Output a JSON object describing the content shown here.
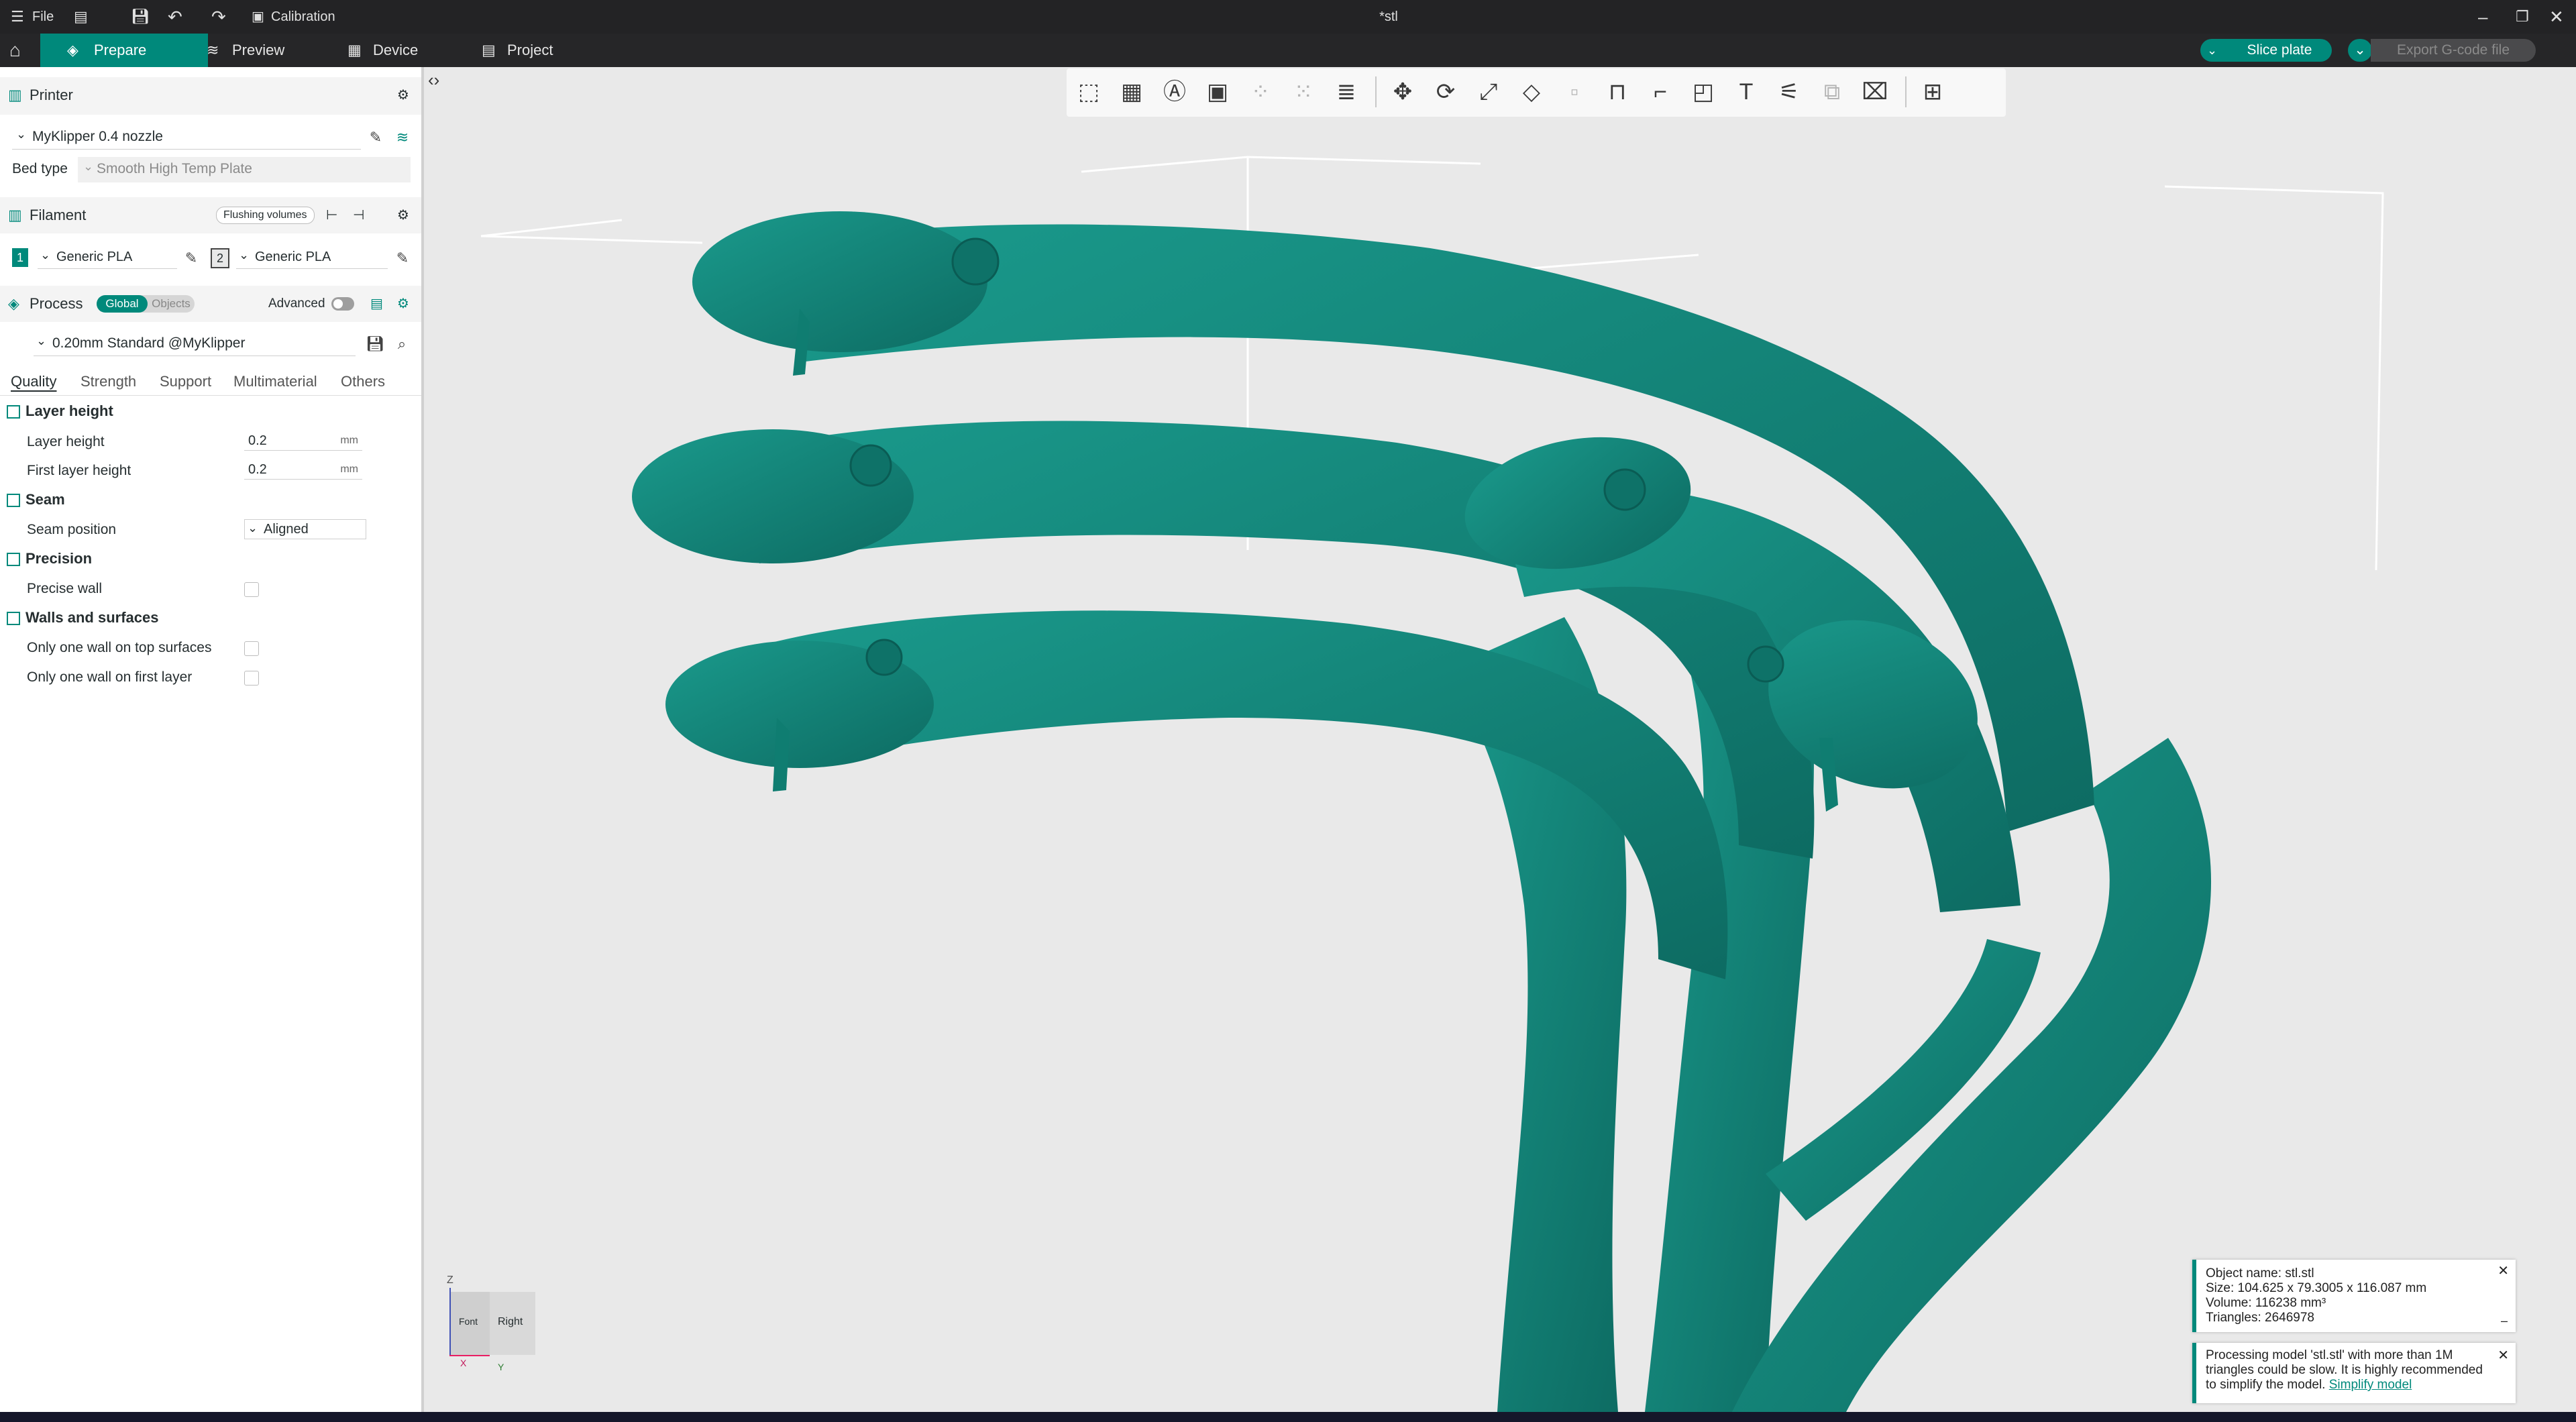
{
  "titlebar": {
    "file_label": "File",
    "calibration_label": "Calibration",
    "title": "*stl"
  },
  "topbar": {
    "tabs": [
      {
        "label": "Prepare"
      },
      {
        "label": "Preview"
      },
      {
        "label": "Device"
      },
      {
        "label": "Project"
      }
    ],
    "slice_label": "Slice plate",
    "export_label": "Export G-code file"
  },
  "printer": {
    "header": "Printer",
    "preset": "MyKlipper 0.4 nozzle",
    "bed_type_label": "Bed type",
    "bed_type_value": "Smooth High Temp Plate"
  },
  "filament": {
    "header": "Filament",
    "flushing_label": "Flushing volumes",
    "slots": [
      {
        "index": "1",
        "name": "Generic PLA"
      },
      {
        "index": "2",
        "name": "Generic PLA"
      }
    ]
  },
  "process": {
    "header": "Process",
    "global_label": "Global",
    "objects_label": "Objects",
    "advanced_label": "Advanced",
    "preset": "0.20mm Standard @MyKlipper",
    "tabs": [
      "Quality",
      "Strength",
      "Support",
      "Multimaterial",
      "Others"
    ],
    "groups": {
      "layer_height": {
        "title": "Layer height",
        "layer_height_label": "Layer height",
        "layer_height_value": "0.2",
        "first_layer_label": "First layer height",
        "first_layer_value": "0.2",
        "unit": "mm"
      },
      "seam": {
        "title": "Seam",
        "position_label": "Seam position",
        "position_value": "Aligned"
      },
      "precision": {
        "title": "Precision",
        "precise_wall_label": "Precise wall"
      },
      "walls": {
        "title": "Walls and surfaces",
        "top_label": "Only one wall on top surfaces",
        "first_label": "Only one wall on first layer"
      }
    }
  },
  "viewport": {
    "axis_z": "Z",
    "axis_x": "X",
    "axis_y": "Y",
    "view_front": "Font",
    "view_right": "Right"
  },
  "notifications": {
    "object_name": "Object name: stl.stl",
    "size": "Size: 104.625 x 79.3005 x 116.087 mm",
    "volume": "Volume: 116238 mm³",
    "triangles": "Triangles: 2646978",
    "warning_text": "Processing model 'stl.stl' with more than 1M triangles could be slow. It is highly recommended to simplify the model.",
    "warning_link": "Simplify model"
  },
  "colors": {
    "accent": "#00897b",
    "model": "#137f74"
  }
}
